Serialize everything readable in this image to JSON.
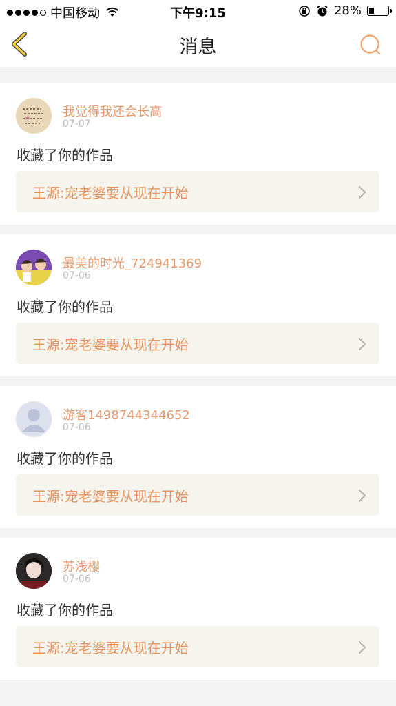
{
  "status_bar": {
    "carrier": "中国移动",
    "time": "下午9:15",
    "battery": "28%"
  },
  "header": {
    "title": "消息",
    "back_icon": "chevron-left-icon",
    "search_icon": "search-icon"
  },
  "colors": {
    "accent": "#e69a6d",
    "back_icon": "#d6b200",
    "box_bg": "#f5f5ee"
  },
  "messages": [
    {
      "username": "我觉得我还会长高",
      "date": "07-07",
      "action": "收藏了你的作品",
      "work_title": "王源:宠老婆要从现在开始"
    },
    {
      "username": "最美的时光_724941369",
      "date": "07-06",
      "action": "收藏了你的作品",
      "work_title": "王源:宠老婆要从现在开始"
    },
    {
      "username": "游客1498744344652",
      "date": "07-06",
      "action": "收藏了你的作品",
      "work_title": "王源:宠老婆要从现在开始"
    },
    {
      "username": "苏浅樱",
      "date": "07-06",
      "action": "收藏了你的作品",
      "work_title": "王源:宠老婆要从现在开始"
    }
  ]
}
